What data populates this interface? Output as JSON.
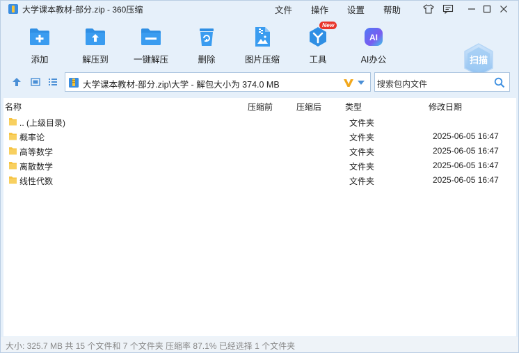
{
  "window": {
    "title": "大学课本教材-部分.zip - 360压缩",
    "menus": [
      "文件",
      "操作",
      "设置",
      "帮助"
    ]
  },
  "toolbar": {
    "items": [
      {
        "label": "添加",
        "icon": "add-icon"
      },
      {
        "label": "解压到",
        "icon": "extract-to-icon"
      },
      {
        "label": "一键解压",
        "icon": "one-click-extract-icon"
      },
      {
        "label": "删除",
        "icon": "delete-icon"
      },
      {
        "label": "图片压缩",
        "icon": "image-compress-icon"
      },
      {
        "label": "工具",
        "icon": "tools-icon",
        "badge": "New"
      },
      {
        "label": "AI办公",
        "icon": "ai-office-icon",
        "icon_text": "AI"
      }
    ],
    "scan_label": "扫描"
  },
  "address": {
    "path": "大学课本教材-部分.zip\\大学 - 解包大小为 374.0 MB",
    "search_placeholder": "搜索包内文件"
  },
  "columns": {
    "name": "名称",
    "compressed": "压缩前",
    "packed": "压缩后",
    "type": "类型",
    "modified": "修改日期"
  },
  "rows": [
    {
      "name": ".. (上级目录)",
      "type": "文件夹",
      "modified": ""
    },
    {
      "name": "概率论",
      "type": "文件夹",
      "modified": "2025-06-05 16:47"
    },
    {
      "name": "高等数学",
      "type": "文件夹",
      "modified": "2025-06-05 16:47"
    },
    {
      "name": "离散数学",
      "type": "文件夹",
      "modified": "2025-06-05 16:47"
    },
    {
      "name": "线性代数",
      "type": "文件夹",
      "modified": "2025-06-05 16:47"
    }
  ],
  "status": {
    "text": "大小: 325.7 MB 共 15 个文件和 7 个文件夹 压缩率 87.1% 已经选择 1 个文件夹"
  },
  "colors": {
    "accent": "#2f8fe4",
    "folder": "#f6c342",
    "badge": "#e8352b",
    "background": "#e6f0fa"
  }
}
